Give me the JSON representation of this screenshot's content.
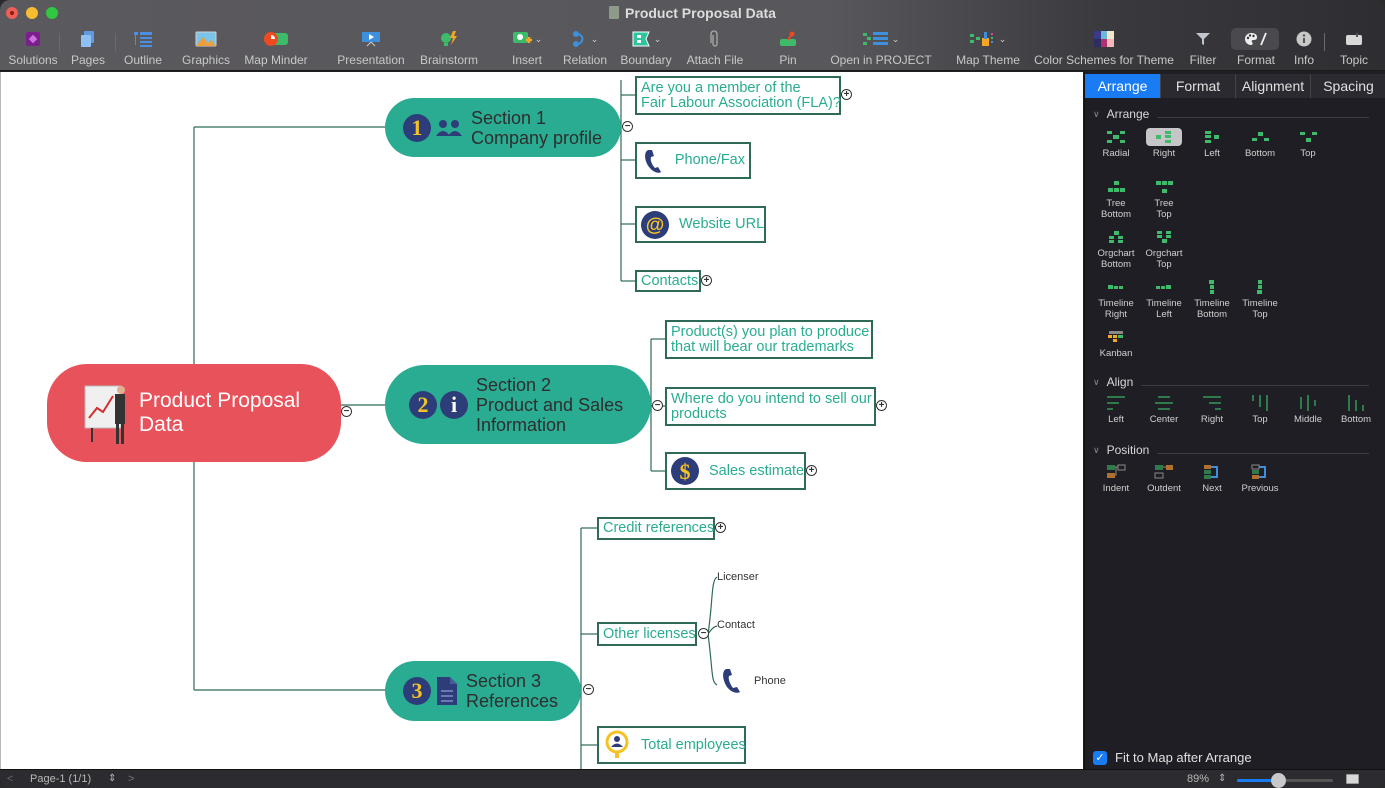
{
  "window": {
    "title": "Product Proposal Data"
  },
  "toolbar": {
    "items": [
      {
        "label": "Solutions",
        "icon": "solutions-icon"
      },
      {
        "label": "Pages",
        "icon": "pages-icon"
      },
      {
        "label": "Outline",
        "icon": "outline-icon"
      },
      {
        "label": "Graphics",
        "icon": "graphics-icon"
      },
      {
        "label": "Map Minder",
        "icon": "map-minder-icon"
      },
      {
        "label": "Presentation",
        "icon": "presentation-icon"
      },
      {
        "label": "Brainstorm",
        "icon": "brainstorm-icon"
      },
      {
        "label": "Insert",
        "icon": "insert-icon"
      },
      {
        "label": "Relation",
        "icon": "relation-icon"
      },
      {
        "label": "Boundary",
        "icon": "boundary-icon"
      },
      {
        "label": "Attach File",
        "icon": "paperclip-icon"
      },
      {
        "label": "Pin",
        "icon": "pin-icon"
      },
      {
        "label": "Open in PROJECT",
        "icon": "project-icon"
      },
      {
        "label": "Map Theme",
        "icon": "map-theme-icon"
      },
      {
        "label": "Color Schemes for Theme",
        "icon": "color-schemes-icon"
      },
      {
        "label": "Filter",
        "icon": "filter-icon"
      },
      {
        "label": "Format",
        "icon": "palette-icon"
      },
      {
        "label": "Info",
        "icon": "info-icon"
      },
      {
        "label": "Topic",
        "icon": "topic-icon"
      }
    ]
  },
  "mindmap": {
    "root": "Product Proposal Data",
    "sections": [
      {
        "number": "1",
        "title_line1": "Section 1",
        "title_line2": "Company profile",
        "children": [
          {
            "line1": "Are you a member of the",
            "line2": "Fair Labour Association (FLA)?"
          },
          {
            "label": "Phone/Fax"
          },
          {
            "label": "Website URL"
          },
          {
            "label": "Contacts"
          }
        ]
      },
      {
        "number": "2",
        "title_line1": "Section 2",
        "title_line2": "Product and Sales",
        "title_line3": "Information",
        "children": [
          {
            "line1": "Product(s) you plan to produce",
            "line2": "that will bear our trademarks"
          },
          {
            "line1": "Where do you intend to sell our",
            "line2": "products"
          },
          {
            "label": "Sales estimate"
          }
        ]
      },
      {
        "number": "3",
        "title_line1": "Section 3",
        "title_line2": "References",
        "children": [
          {
            "label": "Credit references"
          },
          {
            "label": "Other licenses",
            "subtopics": [
              "Licenser",
              "Contact",
              "Phone"
            ]
          },
          {
            "label": "Total employees"
          }
        ]
      }
    ]
  },
  "panel": {
    "tabs": [
      "Arrange",
      "Format",
      "Alignment",
      "Spacing"
    ],
    "active_tab": "Arrange",
    "arrange": {
      "header": "Arrange",
      "selected": "Right",
      "items": [
        {
          "label": "Radial"
        },
        {
          "label": "Right"
        },
        {
          "label": "Left"
        },
        {
          "label": "Bottom"
        },
        {
          "label": "Top"
        },
        {
          "label": "Tree\nBottom"
        },
        {
          "label": "Tree\nTop"
        },
        {
          "label": "Orgchart\nBottom"
        },
        {
          "label": "Orgchart\nTop"
        },
        {
          "label": "Timeline\nRight"
        },
        {
          "label": "Timeline\nLeft"
        },
        {
          "label": "Timeline\nBottom"
        },
        {
          "label": "Timeline\nTop"
        },
        {
          "label": "Kanban"
        }
      ]
    },
    "align": {
      "header": "Align",
      "items": [
        {
          "label": "Left"
        },
        {
          "label": "Center"
        },
        {
          "label": "Right"
        },
        {
          "label": "Top"
        },
        {
          "label": "Middle"
        },
        {
          "label": "Bottom"
        }
      ]
    },
    "position": {
      "header": "Position",
      "items": [
        {
          "label": "Indent"
        },
        {
          "label": "Outdent"
        },
        {
          "label": "Next"
        },
        {
          "label": "Previous"
        }
      ]
    },
    "fit_to_map": {
      "label": "Fit to Map after Arrange",
      "checked": true
    }
  },
  "statusbar": {
    "page": "Page-1 (1/1)",
    "zoom": "89%",
    "zoom_slider_fraction": 0.43
  },
  "colors": {
    "accent": "#1a7cf5",
    "root_fill": "#e8525a",
    "section_fill": "#2aac92",
    "topic_text": "#2aac92",
    "topic_border": "#2f6a58",
    "badge": "#2d3d7a",
    "badge_text": "#f5c223"
  }
}
